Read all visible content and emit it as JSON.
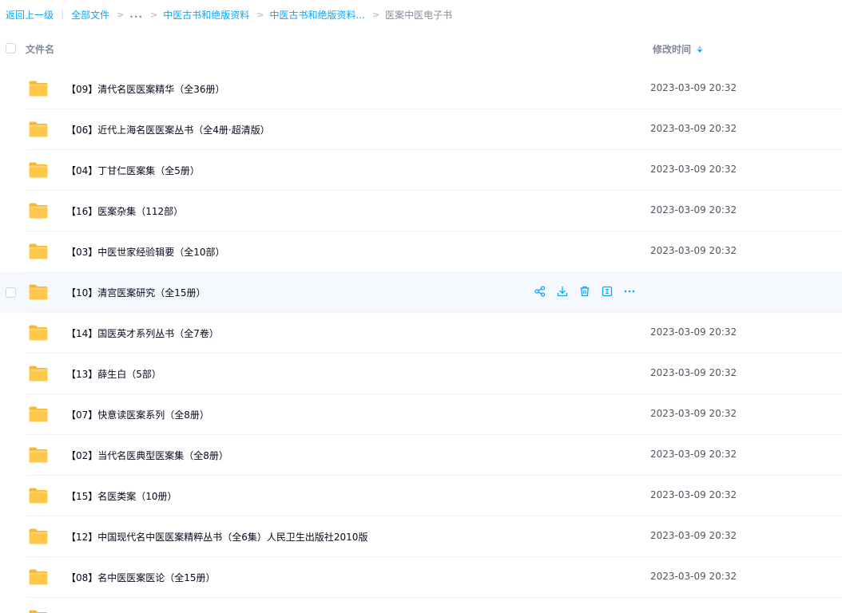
{
  "breadcrumb": {
    "back": "返回上一级",
    "separator": "|",
    "all_files": "全部文件",
    "ellipsis": "...",
    "chevron": ">",
    "level1": "中医古书和绝版资料",
    "level2": "中医古书和绝版资料...",
    "current": "医案中医电子书"
  },
  "table": {
    "col_name": "文件名",
    "col_time": "修改时间",
    "rows": [
      {
        "name": "【09】清代名医医案精华（全36册）",
        "time": "2023-03-09 20:32"
      },
      {
        "name": "【06】近代上海名医医案丛书（全4册·超清版）",
        "time": "2023-03-09 20:32"
      },
      {
        "name": "【04】丁甘仁医案集（全5册）",
        "time": "2023-03-09 20:32"
      },
      {
        "name": "【16】医案杂集（112部）",
        "time": "2023-03-09 20:32"
      },
      {
        "name": "【03】中医世家经验辑要（全10部）",
        "time": "2023-03-09 20:32"
      },
      {
        "name": "【10】清宫医案研究（全15册）",
        "time": ""
      },
      {
        "name": "【14】国医英才系列丛书（全7卷）",
        "time": "2023-03-09 20:32"
      },
      {
        "name": "【13】薛生白（5部）",
        "time": "2023-03-09 20:32"
      },
      {
        "name": "【07】快意读医案系列（全8册）",
        "time": "2023-03-09 20:32"
      },
      {
        "name": "【02】当代名医典型医案集（全8册）",
        "time": "2023-03-09 20:32"
      },
      {
        "name": "【15】名医类案（10册）",
        "time": "2023-03-09 20:32"
      },
      {
        "name": "【12】中国现代名中医医案精粹丛书（全6集）人民卫生出版社2010版",
        "time": "2023-03-09 20:32"
      },
      {
        "name": "【08】名中医医案医论（全15册）",
        "time": "2023-03-09 20:32"
      },
      {
        "name": "",
        "time": ""
      }
    ]
  },
  "icons": {
    "folder": "folder-icon",
    "share": "share-icon",
    "download": "download-icon",
    "delete": "trash-icon",
    "rename": "rename-icon",
    "more": "more-icon",
    "sort": "sort-icon"
  },
  "colors": {
    "link": "#06a7ff",
    "hover_row": "#f5f8fd",
    "folder_yellow": "#ffc84a",
    "folder_tab": "#f7b731",
    "text": "#03081a",
    "muted": "#878c9c"
  }
}
